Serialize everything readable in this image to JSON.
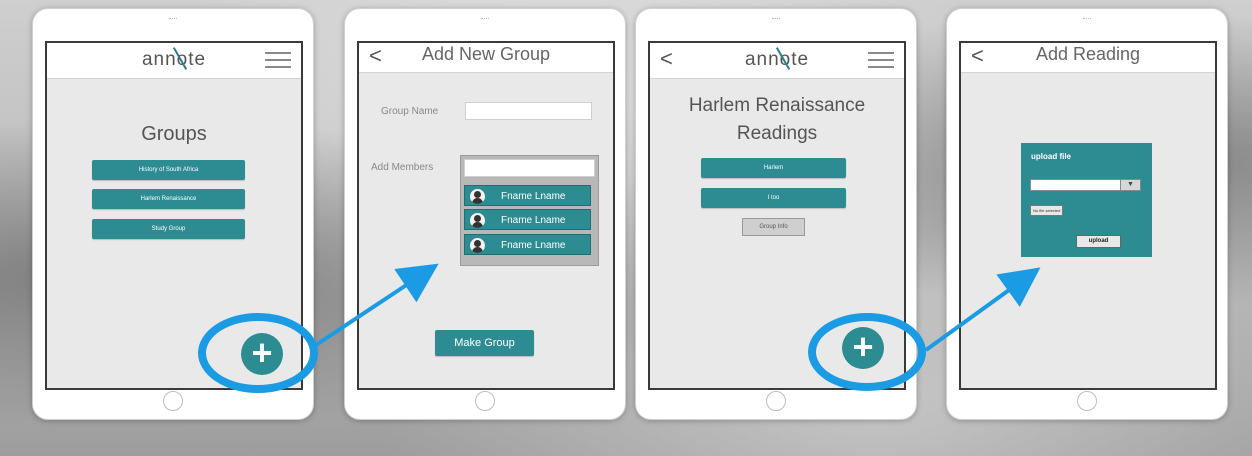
{
  "colors": {
    "teal": "#2d8c92",
    "highlight": "#1b9be3"
  },
  "screen1": {
    "logo": "annote",
    "title": "Groups",
    "groups": [
      "History of South Africa",
      "Harlem Renaissance",
      "Study Group"
    ],
    "fab_symbol": "+"
  },
  "screen2": {
    "back_symbol": "<",
    "title": "Add New Group",
    "group_name_label": "Group Name",
    "add_members_label": "Add Members",
    "members": [
      "Fname Lname",
      "Fname Lname",
      "Fname Lname"
    ],
    "make_group_label": "Make Group"
  },
  "screen3": {
    "back_symbol": "<",
    "logo": "annote",
    "title_line1": "Harlem Renaissance",
    "title_line2": "Readings",
    "readings": [
      "Harlem",
      "I too"
    ],
    "group_info_label": "Group Info",
    "fab_symbol": "+"
  },
  "screen4": {
    "back_symbol": "<",
    "title": "Add Reading",
    "upload_title": "upload file",
    "select_arrow": "▼",
    "no_file_text": "No file selected",
    "upload_button": "upload"
  },
  "icons": {
    "menu": "hamburger-menu-icon",
    "back": "chevron-left-icon",
    "avatar": "user-avatar-icon",
    "add": "plus-icon",
    "flow_arrow": "arrow-right-icon"
  }
}
